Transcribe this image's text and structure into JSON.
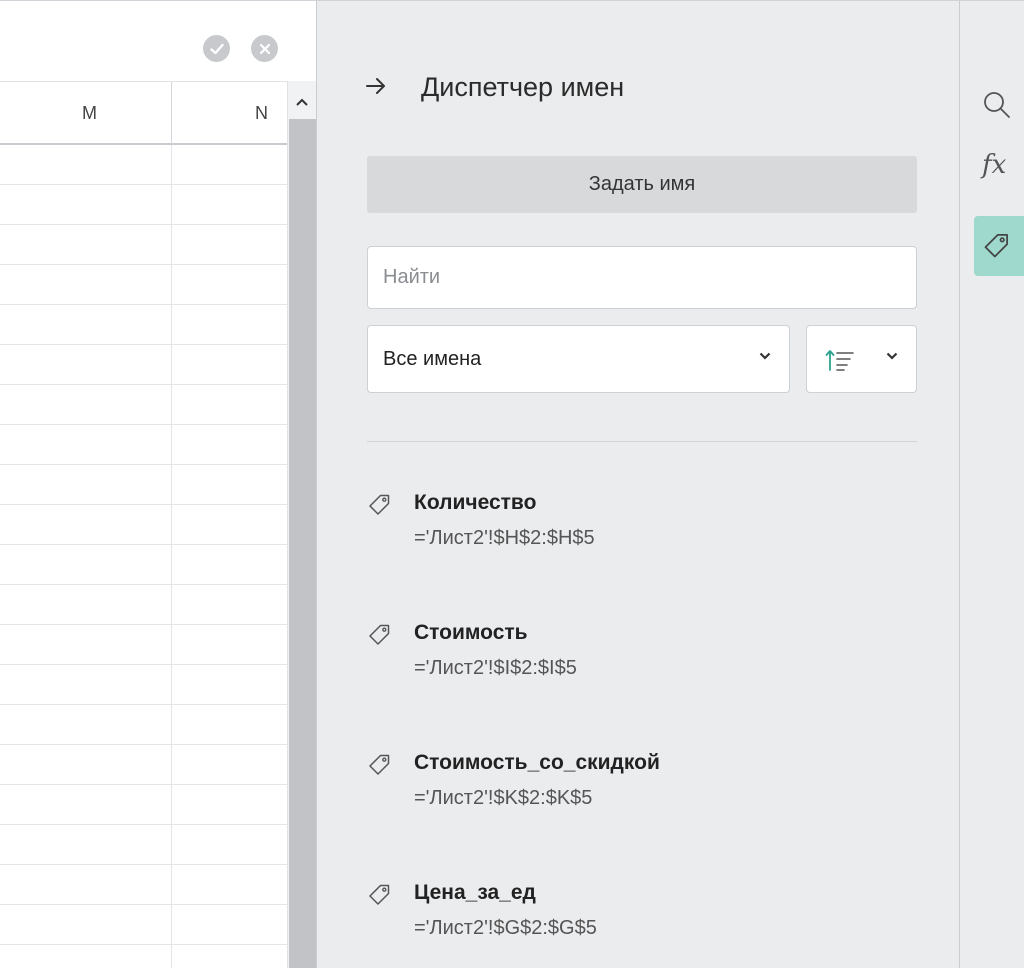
{
  "spreadsheet": {
    "columns": [
      "M",
      "N"
    ],
    "row_count": 21
  },
  "name_manager": {
    "title": "Диспетчер имен",
    "define_name_label": "Задать имя",
    "search_placeholder": "Найти",
    "filter_selected": "Все имена",
    "names": [
      {
        "name": "Количество",
        "ref": "='Лист2'!$H$2:$H$5"
      },
      {
        "name": "Стоимость",
        "ref": "='Лист2'!$I$2:$I$5"
      },
      {
        "name": "Стоимость_со_скидкой",
        "ref": "='Лист2'!$K$2:$K$5"
      },
      {
        "name": "Цена_за_ед",
        "ref": "='Лист2'!$G$2:$G$5"
      }
    ]
  },
  "sidebar": {
    "fx_label": "fx",
    "active_tool": "names"
  },
  "colors": {
    "accent": "#9fd8cd",
    "panel_bg": "#ebecee",
    "sort_arrow": "#2aa38e"
  }
}
